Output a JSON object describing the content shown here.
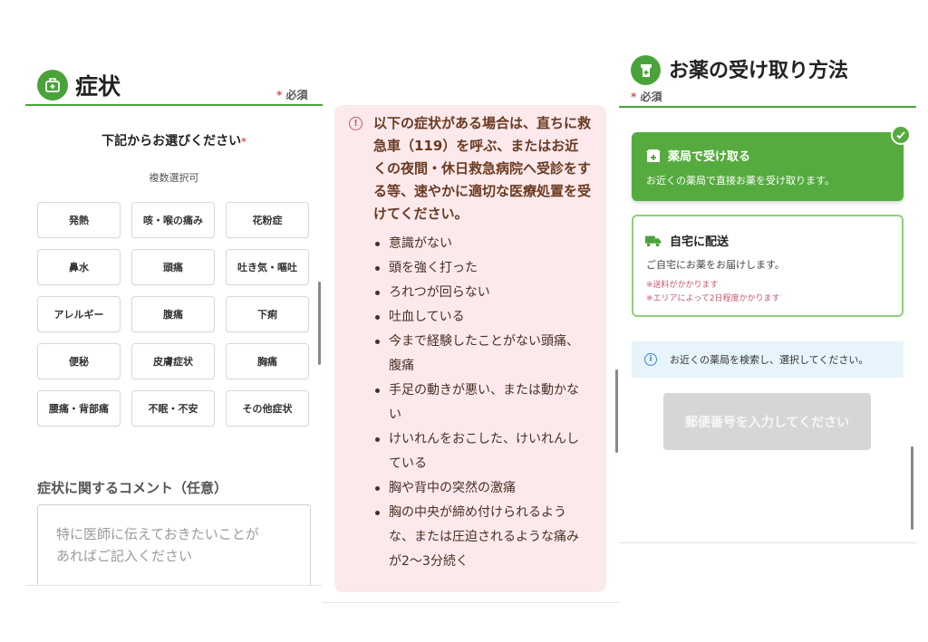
{
  "symptoms": {
    "title": "症状",
    "required": "必須",
    "required_mark": "*",
    "choose_label": "下記からお選びください",
    "multi_select": "複数選択可",
    "chips": [
      "発熱",
      "咳・喉の痛み",
      "花粉症",
      "鼻水",
      "頭痛",
      "吐き気・嘔吐",
      "アレルギー",
      "腹痛",
      "下痢",
      "便秘",
      "皮膚症状",
      "胸痛",
      "腰痛・背部痛",
      "不眠・不安",
      "その他症状"
    ],
    "comment_label": "症状に関するコメント（任意）",
    "comment_placeholder": "特に医師に伝えておきたいことが\nあればご記入ください"
  },
  "warning": {
    "heading": "以下の症状がある場合は、直ちに救急車（119）を呼ぶ、またはお近くの夜間・休日救急病院へ受診をする等、速やかに適切な医療処置を受けてください。",
    "items": [
      "意識がない",
      "頭を強く打った",
      "ろれつが回らない",
      "吐血している",
      "今まで経験したことがない頭痛、腹痛",
      "手足の動きが悪い、または動かない",
      "けいれんをおこした、けいれんしている",
      "胸や背中の突然の激痛",
      "胸の中央が締め付けられるような、または圧迫されるような痛みが2〜3分続く"
    ]
  },
  "pickup": {
    "title": "お薬の受け取り方法",
    "required": "必須",
    "required_mark": "*",
    "options": [
      {
        "title": "薬局で受け取る",
        "desc": "お近くの薬局で直接お薬を受け取ります。",
        "selected": true
      },
      {
        "title": "自宅に配送",
        "desc": "ご自宅にお薬をお届けします。",
        "notes": [
          "※送料がかかります",
          "※エリアによって2日程度かかります"
        ],
        "selected": false
      }
    ],
    "info": "お近くの薬局を検索し、選択してください。",
    "zip_button": "郵便番号を入力してください"
  },
  "colors": {
    "brand_green": "#4aa33a",
    "warning_bg": "#fbe9ec",
    "required_red": "#d9534f",
    "info_bg": "#e8f4fc"
  }
}
